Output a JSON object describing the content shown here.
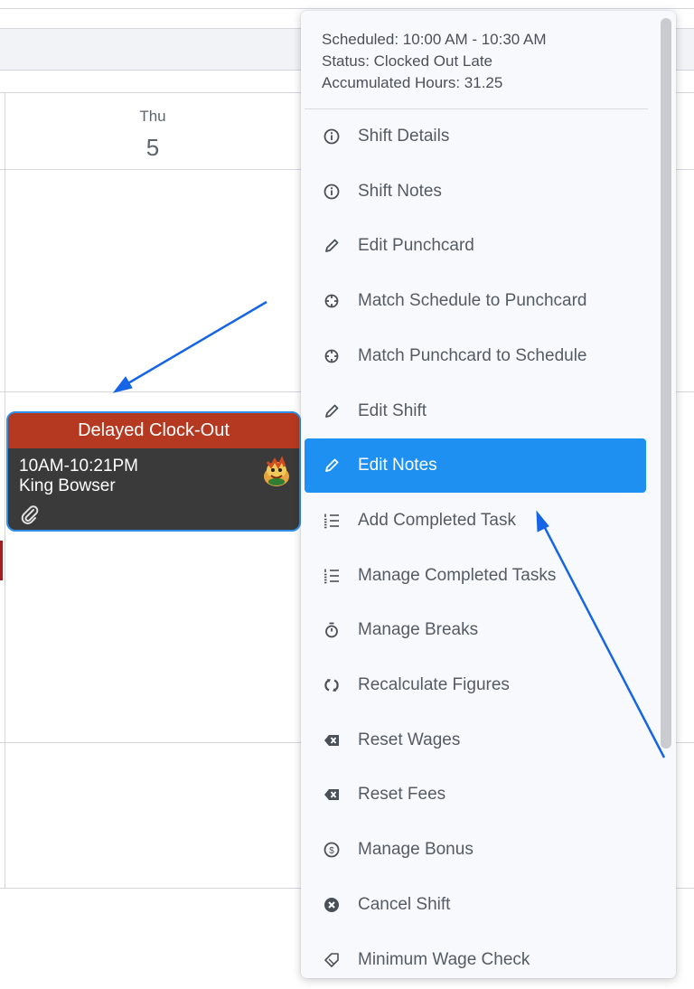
{
  "calendar": {
    "day_name": "Thu",
    "day_number": "5"
  },
  "shift_card": {
    "status": "Delayed Clock-Out",
    "time": "10AM-10:21PM",
    "employee": "King Bowser",
    "status_color": "#b53921",
    "border_color": "#2f8fe6"
  },
  "menu": {
    "info": {
      "scheduled": "Scheduled: 10:00 AM - 10:30 AM",
      "status": "Status: Clocked Out Late",
      "hours": "Accumulated Hours: 31.25"
    },
    "items": [
      {
        "label": "Shift Details",
        "icon": "info-icon"
      },
      {
        "label": "Shift Notes",
        "icon": "info-icon"
      },
      {
        "label": "Edit Punchcard",
        "icon": "pencil-icon"
      },
      {
        "label": "Match Schedule to Punchcard",
        "icon": "crosshair-icon"
      },
      {
        "label": "Match Punchcard to Schedule",
        "icon": "crosshair-icon"
      },
      {
        "label": "Edit Shift",
        "icon": "pencil-icon"
      },
      {
        "label": "Edit Notes",
        "icon": "pencil-icon",
        "highlighted": true
      },
      {
        "label": "Add Completed Task",
        "icon": "list-icon"
      },
      {
        "label": "Manage Completed Tasks",
        "icon": "list-icon"
      },
      {
        "label": "Manage Breaks",
        "icon": "stopwatch-icon"
      },
      {
        "label": "Recalculate Figures",
        "icon": "refresh-icon"
      },
      {
        "label": "Reset Wages",
        "icon": "backspace-icon"
      },
      {
        "label": "Reset Fees",
        "icon": "backspace-icon"
      },
      {
        "label": "Manage Bonus",
        "icon": "dollar-icon"
      },
      {
        "label": "Cancel Shift",
        "icon": "cancel-icon"
      },
      {
        "label": "Minimum Wage Check",
        "icon": "tag-icon"
      }
    ],
    "highlight_color": "#1e90f1"
  },
  "annotation_color": "#1565e6"
}
